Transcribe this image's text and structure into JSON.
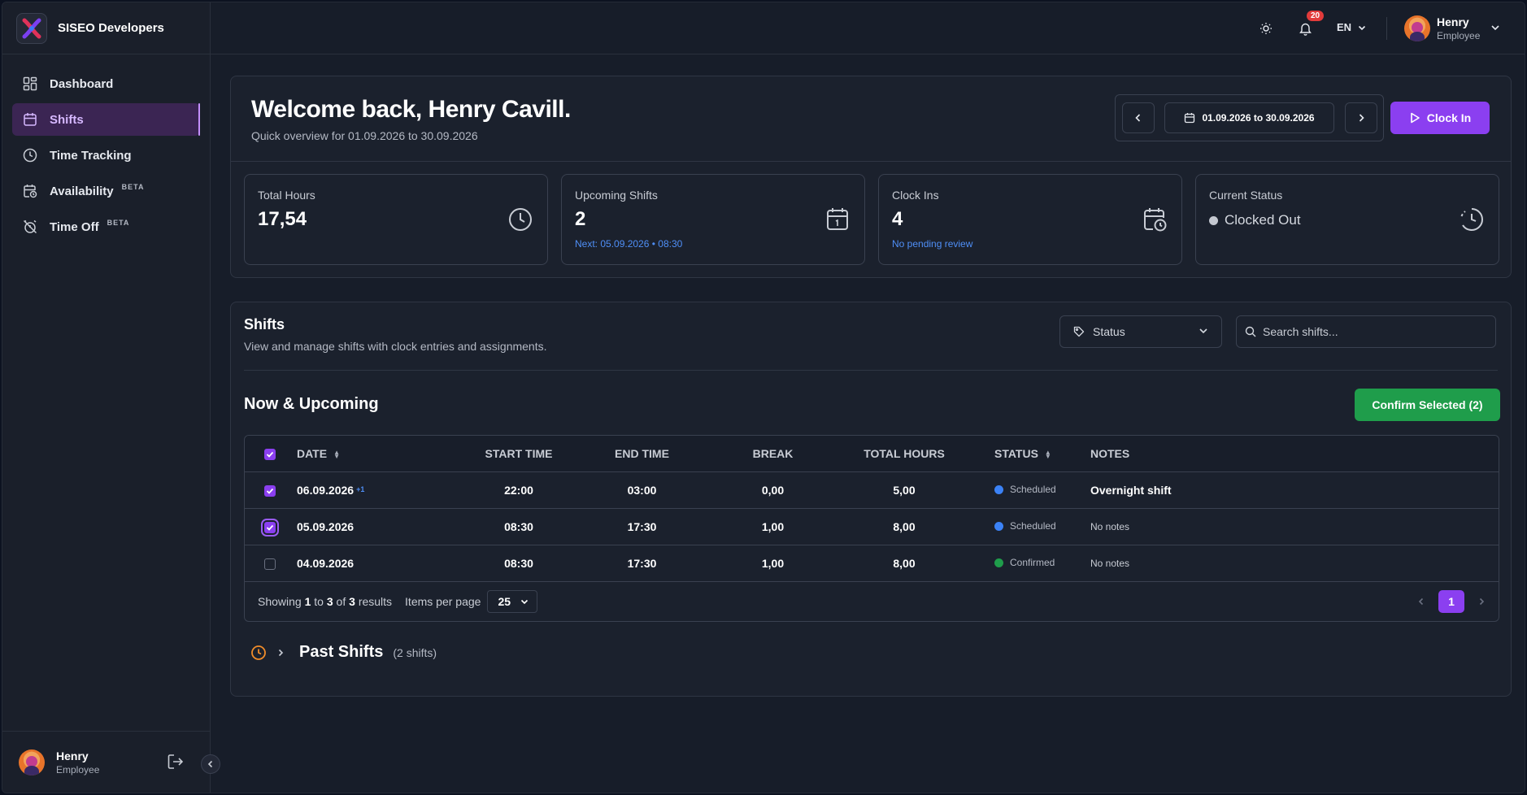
{
  "brand": {
    "name": "SISEO Developers"
  },
  "sidebar": {
    "items": [
      {
        "label": "Dashboard",
        "icon": "grid-icon",
        "active": false
      },
      {
        "label": "Shifts",
        "icon": "calendar-icon",
        "active": true
      },
      {
        "label": "Time Tracking",
        "icon": "clock-icon",
        "active": false
      },
      {
        "label": "Availability",
        "icon": "calendar-clock-icon",
        "active": false,
        "tag": "BETA"
      },
      {
        "label": "Time Off",
        "icon": "alarm-off-icon",
        "active": false,
        "tag": "BETA"
      }
    ],
    "user": {
      "name": "Henry",
      "role": "Employee"
    }
  },
  "topbar": {
    "notifications_count": "20",
    "language": "EN",
    "user": {
      "name": "Henry",
      "role": "Employee"
    }
  },
  "welcome": {
    "title": "Welcome back, Henry Cavill.",
    "subtitle": "Quick overview for 01.09.2026 to 30.09.2026",
    "date_range": "01.09.2026 to 30.09.2026",
    "clock_in_label": "Clock In"
  },
  "stats": {
    "total_hours": {
      "label": "Total Hours",
      "value": "17,54"
    },
    "upcoming": {
      "label": "Upcoming Shifts",
      "value": "2",
      "sub": "Next: 05.09.2026 • 08:30"
    },
    "clock_ins": {
      "label": "Clock Ins",
      "value": "4",
      "sub": "No pending review"
    },
    "status": {
      "label": "Current Status",
      "value": "Clocked Out"
    }
  },
  "shifts": {
    "title": "Shifts",
    "subtitle": "View and manage shifts with clock entries and assignments.",
    "status_filter": "Status",
    "search_placeholder": "Search shifts...",
    "section_title": "Now & Upcoming",
    "confirm_label": "Confirm Selected (2)",
    "columns": [
      "DATE",
      "START TIME",
      "END TIME",
      "BREAK",
      "TOTAL HOURS",
      "STATUS",
      "NOTES"
    ],
    "rows": [
      {
        "date": "06.09.2026",
        "extra": "+1",
        "start": "22:00",
        "end": "03:00",
        "break": "0,00",
        "total": "5,00",
        "status": "Scheduled",
        "notes": "Overnight shift",
        "checked": true
      },
      {
        "date": "05.09.2026",
        "extra": "",
        "start": "08:30",
        "end": "17:30",
        "break": "1,00",
        "total": "8,00",
        "status": "Scheduled",
        "notes": "No notes",
        "checked": true
      },
      {
        "date": "04.09.2026",
        "extra": "",
        "start": "08:30",
        "end": "17:30",
        "break": "1,00",
        "total": "8,00",
        "status": "Confirmed",
        "notes": "No notes",
        "checked": false
      }
    ],
    "pagination": {
      "showing_prefix": "Showing",
      "from": "1",
      "to_word": "to",
      "to": "3",
      "of_word": "of",
      "total": "3",
      "results_word": "results",
      "items_per_page_label": "Items per page",
      "items_per_page": "25",
      "current_page": "1"
    },
    "past": {
      "title": "Past Shifts",
      "count": "(2 shifts)"
    }
  },
  "colors": {
    "accent": "#8b3ff0",
    "confirm": "#1f9d4b",
    "scheduled": "#3b82f6",
    "confirmed": "#1f9d4b",
    "badge": "#e23b3b"
  }
}
